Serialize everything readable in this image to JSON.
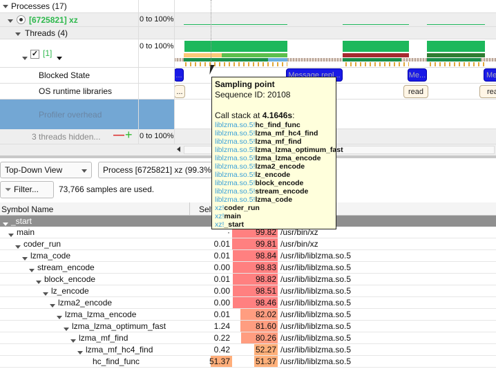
{
  "timeline": {
    "processes_label": "Processes (17)",
    "process": {
      "label": "[6725821] xz",
      "range": "0 to 100%"
    },
    "threads_label": "Threads (4)",
    "thread": {
      "label": "[1]",
      "range": "0 to 100%",
      "checked": true
    },
    "blocked_state": {
      "label": "Blocked State",
      "events": [
        "...",
        "Message repl...",
        "Me...",
        "Me"
      ]
    },
    "os_runtime": {
      "label": "OS runtime libraries",
      "events": [
        "...",
        "read",
        "rea"
      ]
    },
    "profiler_overhead": "Profiler overhead",
    "hidden": {
      "label": "3 threads hidden...",
      "range": "0 to 100%"
    }
  },
  "tooltip": {
    "title": "Sampling point",
    "sequence": "Sequence ID: 20108",
    "callstack_prefix": "Call stack at ",
    "callstack_time": "4.1646s",
    "callstack_suffix": ":",
    "frames": [
      {
        "module": "liblzma.so.5!",
        "func": "hc_find_func"
      },
      {
        "module": "liblzma.so.5!",
        "func": "lzma_mf_hc4_find"
      },
      {
        "module": "liblzma.so.5!",
        "func": "lzma_mf_find"
      },
      {
        "module": "liblzma.so.5!",
        "func": "lzma_lzma_optimum_fast"
      },
      {
        "module": "liblzma.so.5!",
        "func": "lzma_lzma_encode"
      },
      {
        "module": "liblzma.so.5!",
        "func": "lzma2_encode"
      },
      {
        "module": "liblzma.so.5!",
        "func": "lz_encode"
      },
      {
        "module": "liblzma.so.5!",
        "func": "block_encode"
      },
      {
        "module": "liblzma.so.5!",
        "func": "stream_encode"
      },
      {
        "module": "liblzma.so.5!",
        "func": "lzma_code"
      },
      {
        "module": "xz!",
        "func": "coder_run"
      },
      {
        "module": "xz!",
        "func": "main"
      },
      {
        "module": "xz!",
        "func": "_start"
      }
    ]
  },
  "toolbar": {
    "view": "Top-Down View",
    "process": "Process [6725821] xz (99.3%, ",
    "filter": "Filter...",
    "samples": "73,766 samples are used."
  },
  "table": {
    "headers": {
      "symbol": "Symbol Name",
      "self": "Self"
    },
    "root": "_start",
    "rows": [
      {
        "name": "main",
        "self": "·",
        "total": "99.82",
        "module": "/usr/bin/xz",
        "depth": 1
      },
      {
        "name": "coder_run",
        "self": "0.01",
        "total": "99.81",
        "module": "/usr/bin/xz",
        "depth": 2
      },
      {
        "name": "lzma_code",
        "self": "0.01",
        "total": "98.84",
        "module": "/usr/lib/liblzma.so.5",
        "depth": 3
      },
      {
        "name": "stream_encode",
        "self": "0.00",
        "total": "98.83",
        "module": "/usr/lib/liblzma.so.5",
        "depth": 4
      },
      {
        "name": "block_encode",
        "self": "0.01",
        "total": "98.82",
        "module": "/usr/lib/liblzma.so.5",
        "depth": 5
      },
      {
        "name": "lz_encode",
        "self": "0.00",
        "total": "98.51",
        "module": "/usr/lib/liblzma.so.5",
        "depth": 6
      },
      {
        "name": "lzma2_encode",
        "self": "0.00",
        "total": "98.46",
        "module": "/usr/lib/liblzma.so.5",
        "depth": 7
      },
      {
        "name": "lzma_lzma_encode",
        "self": "0.01",
        "total": "82.02",
        "module": "/usr/lib/liblzma.so.5",
        "depth": 8
      },
      {
        "name": "lzma_lzma_optimum_fast",
        "self": "1.24",
        "total": "81.60",
        "module": "/usr/lib/liblzma.so.5",
        "depth": 9
      },
      {
        "name": "lzma_mf_find",
        "self": "0.22",
        "total": "80.26",
        "module": "/usr/lib/liblzma.so.5",
        "depth": 10
      },
      {
        "name": "lzma_mf_hc4_find",
        "self": "0.42",
        "total": "52.27",
        "module": "/usr/lib/liblzma.so.5",
        "depth": 11
      },
      {
        "name": "hc_find_func",
        "self": "51.37",
        "total": "51.37",
        "module": "/usr/lib/liblzma.so.5",
        "depth": 12
      }
    ]
  }
}
